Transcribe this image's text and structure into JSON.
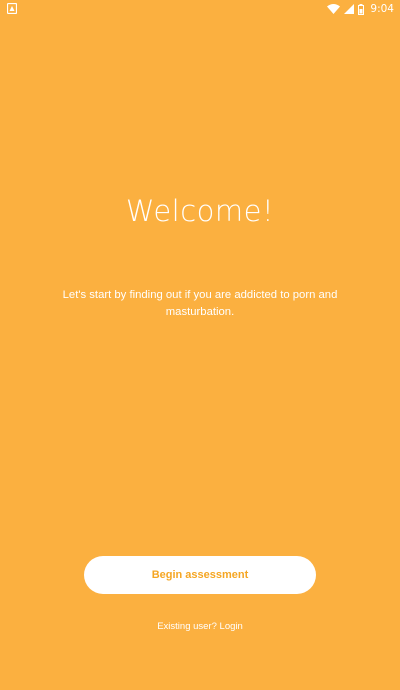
{
  "status_bar": {
    "time": "9:04",
    "icons": [
      "notification-icon",
      "wifi-icon",
      "signal-icon",
      "battery-icon"
    ]
  },
  "welcome": {
    "title": "Welcome!",
    "intro": "Let's start by finding out if you are addicted to porn and masturbation."
  },
  "actions": {
    "begin_label": "Begin assessment",
    "existing_user_text": "Existing user?",
    "login_label": "Login"
  },
  "colors": {
    "background": "#FBB040",
    "button_text": "#F5A623",
    "button_bg": "#FFFFFF",
    "text": "#FFFFFF"
  }
}
